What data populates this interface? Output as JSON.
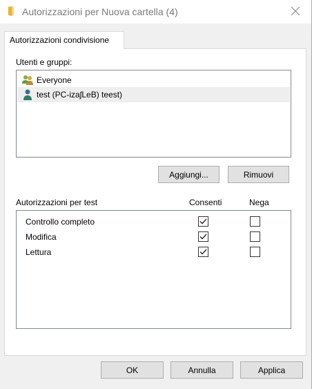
{
  "window": {
    "title": "Autorizzazioni per Nuova cartella (4)",
    "icons": {
      "title": "folder-icon",
      "close": "close-icon"
    }
  },
  "tabs": [
    {
      "label": "Autorizzazioni condivisione",
      "selected": true
    }
  ],
  "users_section": {
    "label": "Utenti e gruppi:",
    "items": [
      {
        "label": "Everyone",
        "icon": "group-icon",
        "selected": false
      },
      {
        "label": "test (PC-izaʃLeB) teest)",
        "icon": "user-icon",
        "selected": true
      }
    ]
  },
  "user_buttons": {
    "add": "Aggiungi...",
    "remove": "Rimuovi"
  },
  "permissions": {
    "header": "Autorizzazioni per test",
    "columns": {
      "allow": "Consenti",
      "deny": "Nega"
    },
    "rows": [
      {
        "name": "Controllo completo",
        "allow": true,
        "deny": false
      },
      {
        "name": "Modifica",
        "allow": true,
        "deny": false
      },
      {
        "name": "Lettura",
        "allow": true,
        "deny": false
      }
    ]
  },
  "footer": {
    "ok": "OK",
    "cancel": "Annulla",
    "apply": "Applica"
  },
  "colors": {
    "window_bg": "#f0f0f0",
    "panel_bg": "#ffffff",
    "selection": "#eeeeee",
    "border": "#828790"
  }
}
